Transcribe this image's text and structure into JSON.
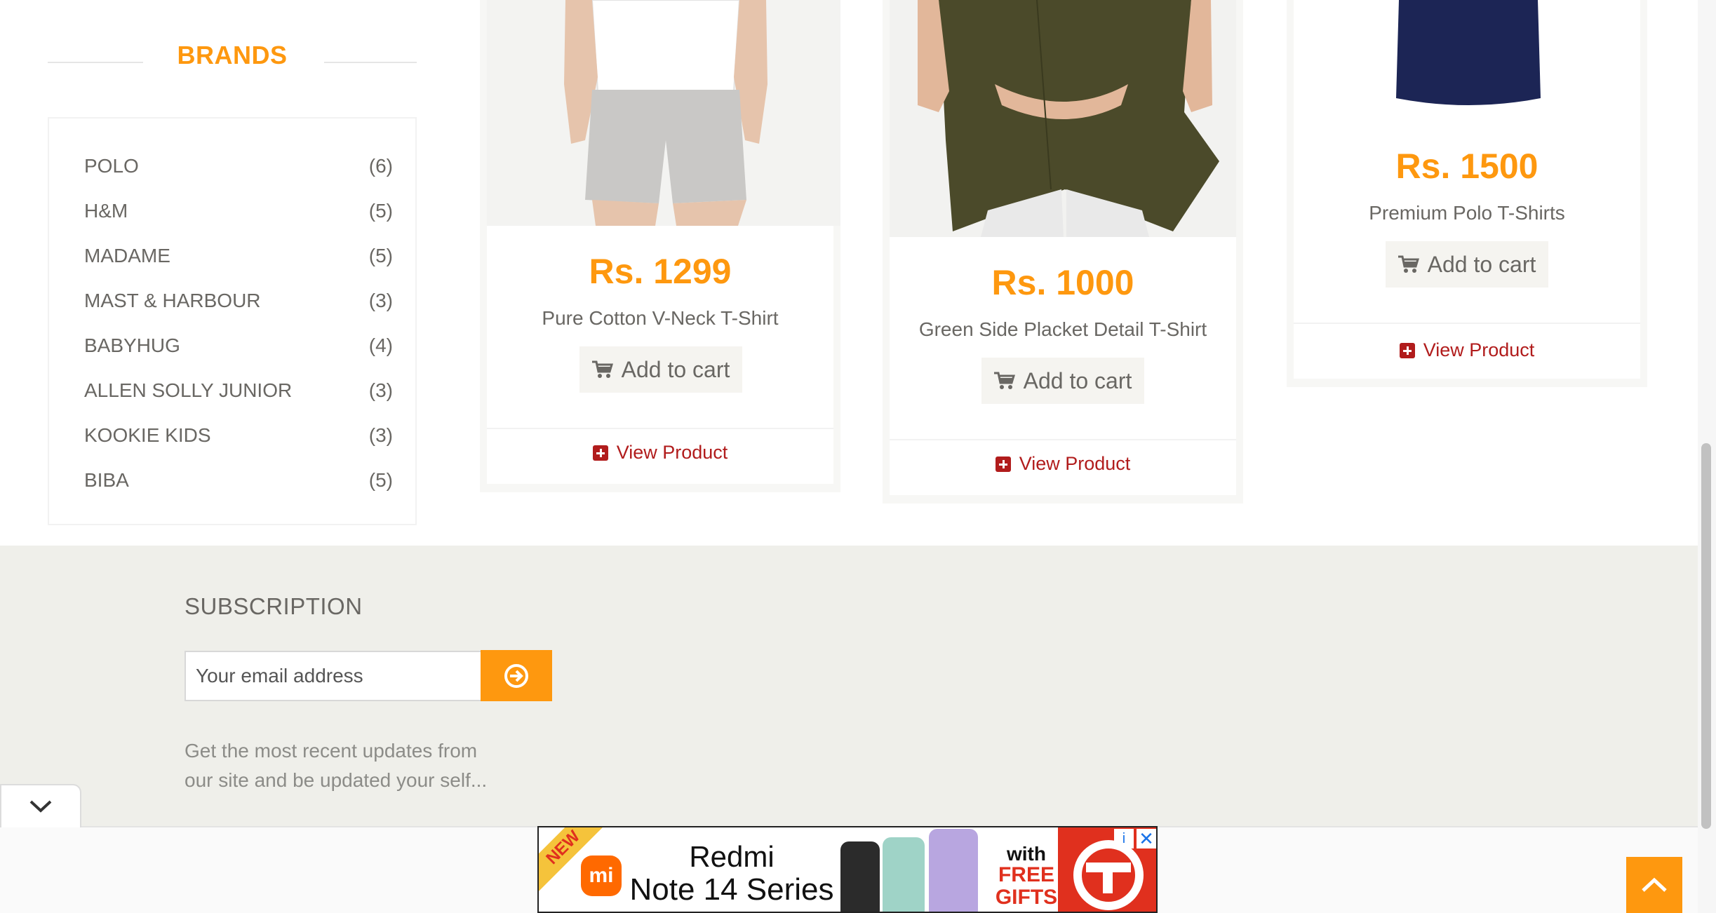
{
  "brands": {
    "title": "BRANDS",
    "items": [
      {
        "name": "POLO",
        "count": "(6)"
      },
      {
        "name": "H&M",
        "count": "(5)"
      },
      {
        "name": "MADAME",
        "count": "(5)"
      },
      {
        "name": "MAST & HARBOUR",
        "count": "(3)"
      },
      {
        "name": "BABYHUG",
        "count": "(4)"
      },
      {
        "name": "ALLEN SOLLY JUNIOR",
        "count": "(3)"
      },
      {
        "name": "KOOKIE KIDS",
        "count": "(3)"
      },
      {
        "name": "BIBA",
        "count": "(5)"
      }
    ]
  },
  "products": [
    {
      "price": "Rs. 1299",
      "name": "Pure Cotton V-Neck T-Shirt",
      "add_to_cart": "Add to cart",
      "view": "View Product"
    },
    {
      "price": "Rs. 1000",
      "name": "Green Side Placket Detail T-Shirt",
      "add_to_cart": "Add to cart",
      "view": "View Product"
    },
    {
      "price": "Rs. 1500",
      "name": "Premium Polo T-Shirts",
      "add_to_cart": "Add to cart",
      "view": "View Product"
    }
  ],
  "subscription": {
    "title": "SUBSCRIPTION",
    "placeholder": "Your email address",
    "description": "Get the most recent updates from our site and be updated your self..."
  },
  "ad": {
    "badge": "NEW",
    "logo": "mi",
    "line1": "Redmi",
    "line2": "Note 14 Series",
    "with": "with",
    "free": "FREE",
    "gifts": "GIFTS",
    "info": "i",
    "close": "✕"
  },
  "colors": {
    "accent": "#fe980f",
    "link": "#b11c1c",
    "footer_bg": "#efefea"
  }
}
